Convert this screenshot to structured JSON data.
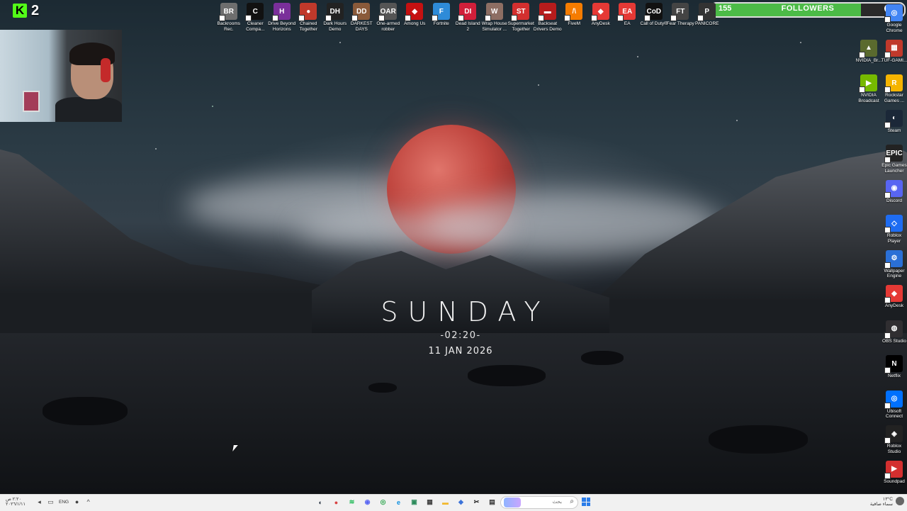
{
  "overlay": {
    "kick_count": "2",
    "followers": {
      "current": "155",
      "label": "FOLLOWERS",
      "goal": "200",
      "progress_fraction": 0.775,
      "bar_color": "#4cbb47"
    }
  },
  "widget": {
    "day": "SUNDAY",
    "time": "-02:20-",
    "date": "11 JAN 2026"
  },
  "top_icons": [
    {
      "label": "Backrooms Rec.",
      "icon": "backrooms-icon",
      "color": "#6e6e6e",
      "glyph": "BR"
    },
    {
      "label": "Cleaner Compa...",
      "icon": "cleaner-icon",
      "color": "#111111",
      "glyph": "C"
    },
    {
      "label": "Drive Beyond Horizons",
      "icon": "drive-beyond-icon",
      "color": "#7a2f9a",
      "glyph": "H"
    },
    {
      "label": "Chained Together",
      "icon": "chained-together-icon",
      "color": "#c0392b",
      "glyph": "●"
    },
    {
      "label": "Dark Hours Demo",
      "icon": "dark-hours-icon",
      "color": "#222222",
      "glyph": "DH"
    },
    {
      "label": "DARKEST DAYS",
      "icon": "darkest-days-icon",
      "color": "#8a5a3a",
      "glyph": "DD"
    },
    {
      "label": "One-armed robber",
      "icon": "one-armed-robber-icon",
      "color": "#555555",
      "glyph": "OAR"
    },
    {
      "label": "Among Us",
      "icon": "among-us-icon",
      "color": "#c51111",
      "glyph": "◆"
    },
    {
      "label": "Fortnite",
      "icon": "fortnite-icon",
      "color": "#2e8bd8",
      "glyph": "F"
    },
    {
      "label": "Dead Island 2",
      "icon": "dead-island-icon",
      "color": "#d11f3a",
      "glyph": "DI"
    },
    {
      "label": "Wrap House Simulator ...",
      "icon": "wrap-house-icon",
      "color": "#8d6e63",
      "glyph": "W"
    },
    {
      "label": "Supermarket Together",
      "icon": "supermarket-icon",
      "color": "#d32f2f",
      "glyph": "ST"
    },
    {
      "label": "Backseat Drivers Demo",
      "icon": "backseat-drivers-icon",
      "color": "#b71c1c",
      "glyph": "▬"
    },
    {
      "label": "FiveM",
      "icon": "fivem-icon",
      "color": "#f57c00",
      "glyph": "/\\"
    },
    {
      "label": "AnyDesk",
      "icon": "anydesk-icon",
      "color": "#e53935",
      "glyph": "◆"
    },
    {
      "label": "EA",
      "icon": "ea-icon",
      "color": "#e53935",
      "glyph": "EA"
    },
    {
      "label": "Call of Duty®",
      "icon": "call-of-duty-icon",
      "color": "#111111",
      "glyph": "CoD"
    },
    {
      "label": "Fear Therapy",
      "icon": "fear-therapy-icon",
      "color": "#444444",
      "glyph": "FT"
    },
    {
      "label": "PANICORE",
      "icon": "panicore-icon",
      "color": "#333333",
      "glyph": "P"
    }
  ],
  "side_icons": [
    {
      "label": "Google Chrome",
      "icon": "chrome-icon",
      "color": "#4285f4",
      "glyph": "◎"
    },
    {
      "label": "TUF-GAMI...",
      "icon": "tuf-gaming-icon",
      "color": "#c0392b",
      "glyph": "▦"
    },
    {
      "label": "Rockstar Games ...",
      "icon": "rockstar-icon",
      "color": "#f5b400",
      "glyph": "R"
    },
    {
      "label": "Steam",
      "icon": "steam-icon",
      "color": "#1b2838",
      "glyph": "◐"
    },
    {
      "label": "Epic Games Launcher",
      "icon": "epic-games-icon",
      "color": "#222222",
      "glyph": "EPIC"
    },
    {
      "label": "Discord",
      "icon": "discord-icon",
      "color": "#5865f2",
      "glyph": "◉"
    },
    {
      "label": "Roblox Player",
      "icon": "roblox-icon",
      "color": "#1e6cf2",
      "glyph": "◇"
    },
    {
      "label": "Wallpaper Engine",
      "icon": "wallpaper-engine-icon",
      "color": "#2a6fd6",
      "glyph": "⚙"
    },
    {
      "label": "AnyDesk",
      "icon": "anydesk-icon",
      "color": "#e53935",
      "glyph": "◆"
    },
    {
      "label": "OBS Studio",
      "icon": "obs-icon",
      "color": "#302e31",
      "glyph": "◍"
    },
    {
      "label": "Netflix",
      "icon": "netflix-icon",
      "color": "#000000",
      "glyph": "N"
    },
    {
      "label": "Ubisoft Connect",
      "icon": "ubisoft-icon",
      "color": "#0070ff",
      "glyph": "◎"
    },
    {
      "label": "Roblox Studio",
      "icon": "roblox-studio-icon",
      "color": "#222222",
      "glyph": "◈"
    },
    {
      "label": "Soundpad",
      "icon": "soundpad-icon",
      "color": "#d32f2f",
      "glyph": "▶"
    }
  ],
  "side_icons_col2": [
    {
      "label": "NVIDIA_Br...",
      "icon": "nvidia-icon",
      "color": "#5a6a2e",
      "glyph": "▲"
    },
    {
      "label": "NVIDIA Broadcast",
      "icon": "nvidia-broadcast-icon",
      "color": "#76b900",
      "glyph": "▶"
    }
  ],
  "taskbar": {
    "clock_line1": "٢:٢٠ ص",
    "clock_line2": "٢٠٢٦/١/١١",
    "lang": "ENG",
    "search_placeholder": "بحث",
    "weather_line1": "١٣°C",
    "weather_line2": "سماء صافية",
    "apps": [
      {
        "icon": "steam-taskbar-icon",
        "color": "#1b2838",
        "glyph": "◐"
      },
      {
        "icon": "obs-taskbar-icon",
        "color": "#d84343",
        "glyph": "●"
      },
      {
        "icon": "spotify-icon",
        "color": "#1db954",
        "glyph": "≋"
      },
      {
        "icon": "discord-taskbar-icon",
        "color": "#5865f2",
        "glyph": "◉"
      },
      {
        "icon": "chrome-taskbar-icon",
        "color": "#34a853",
        "glyph": "◎"
      },
      {
        "icon": "edge-icon",
        "color": "#0c8fe0",
        "glyph": "e"
      },
      {
        "icon": "photos-icon",
        "color": "#2a8a5a",
        "glyph": "▣"
      },
      {
        "icon": "calculator-icon",
        "color": "#444444",
        "glyph": "▦"
      },
      {
        "icon": "file-explorer-icon",
        "color": "#f2b82c",
        "glyph": "▬"
      },
      {
        "icon": "media-icon",
        "color": "#3b73d9",
        "glyph": "◆"
      },
      {
        "icon": "capcut-icon",
        "color": "#222222",
        "glyph": "✂"
      },
      {
        "icon": "notes-icon",
        "color": "#333333",
        "glyph": "▤"
      }
    ]
  }
}
